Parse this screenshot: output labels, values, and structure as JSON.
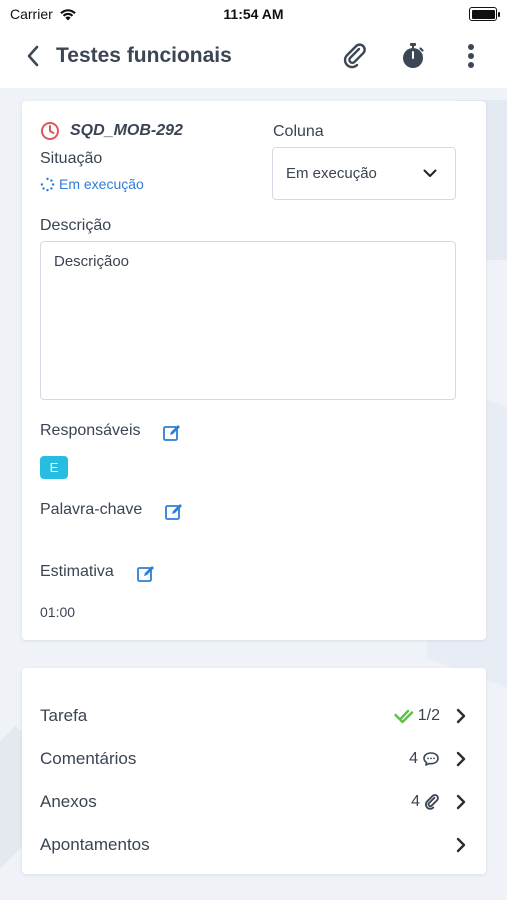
{
  "status_bar": {
    "carrier": "Carrier",
    "time": "11:54 AM"
  },
  "nav": {
    "title": "Testes funcionais"
  },
  "issue": {
    "id": "SQD_MOB-292",
    "situacao_label": "Situação",
    "situacao_value": "Em execução",
    "coluna_label": "Coluna",
    "coluna_value": "Em execução",
    "descricao_label": "Descrição",
    "descricao_value": "Descriçãoo",
    "responsaveis_label": "Responsáveis",
    "responsavel_initial": "E",
    "palavra_chave_label": "Palavra-chave",
    "estimativa_label": "Estimativa",
    "estimativa_value": "01:00"
  },
  "list": {
    "tarefa": {
      "label": "Tarefa",
      "count": "1/2"
    },
    "comentarios": {
      "label": "Comentários",
      "count": "4"
    },
    "anexos": {
      "label": "Anexos",
      "count": "4"
    },
    "apontamentos": {
      "label": "Apontamentos"
    }
  },
  "colors": {
    "accent": "#2e7dd6",
    "alert": "#e0565b",
    "success": "#5cc144",
    "avatar": "#26bde0"
  }
}
